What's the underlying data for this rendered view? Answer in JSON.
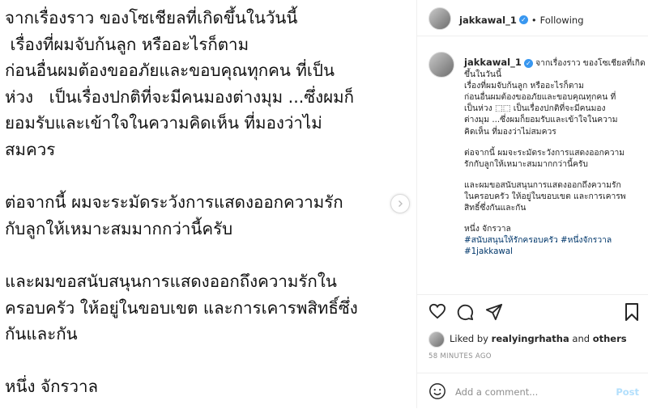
{
  "media": {
    "lines": [
      "จากเรื่องราว ของโซเชียลที่เกิดขึ้นในวันนี้",
      " เรื่องที่ผมจับก้นลูก หรืออะไรก็ตาม",
      "ก่อนอื่นผมต้องขออภัยและขอบคุณทุกคน ที่เป็น",
      "ห่วง   เป็นเรื่องปกติที่จะมีคนมองต่างมุม ...ซึ่งผมก็",
      "ยอมรับและเข้าใจในความคิดเห็น ที่มองว่าไม่",
      "สมควร",
      "",
      "ต่อจากนี้ ผมจะระมัดระวังการแสดงออกความรัก",
      "กับลูกให้เหมาะสมมากกว่านี้ครับ",
      "",
      "และผมขอสนับสนุนการแสดงออกถึงความรักใน",
      "ครอบครัว ให้อยู่ในขอบเขต และการเคารพสิทธิ์ซึ่ง",
      "กันและกัน",
      "",
      "หนึ่ง จักรวาล"
    ]
  },
  "header": {
    "username": "jakkawal_1",
    "separator": "•",
    "follow_status": "Following"
  },
  "caption": {
    "username": "jakkawal_1",
    "para1": "จากเรื่องราว ของโซเชียลที่เกิดขึ้นในวันนี้\nเรื่องที่ผมจับก้นลูก หรืออะไรก็ตาม\nก่อนอื่นผมต้องขออภัยและขอบคุณทุกคน ที่\nเป็นห่วง ⬚⬚ เป็นเรื่องปกติที่จะมีคนมอง\nต่างมุม ...ซึ่งผมก็ยอมรับและเข้าใจในความ\nคิดเห็น ที่มองว่าไม่สมควร",
    "para2": "ต่อจากนี้ ผมจะระมัดระวังการแสดงออกความ\nรักกับลูกให้เหมาะสมมากกว่านี้ครับ",
    "para3": "และผมขอสนับสนุนการแสดงออกถึงความรัก\nในครอบครัว ให้อยู่ในขอบเขต และการเคารพ\nสิทธิ์ซึ่งกันและกัน",
    "signature": "หนึ่ง จักรวาล",
    "hashtags": "#สนับสนุนให้รักครอบครัว #หนึ่งจักรวาล\n#1jakkawal"
  },
  "likes": {
    "prefix": "Liked by",
    "user": "realyingrhatha",
    "and": "and",
    "others": "others"
  },
  "timestamp": "58 MINUTES AGO",
  "comment": {
    "placeholder": "Add a comment...",
    "post_label": "Post"
  },
  "colors": {
    "verified": "#3897f0",
    "hashtag": "#00376b",
    "post_disabled": "#b2dffc",
    "muted": "#8e8e8e"
  },
  "icons": [
    "next-arrow-icon",
    "verified-icon",
    "heart-icon",
    "comment-icon",
    "share-icon",
    "bookmark-icon",
    "emoji-icon"
  ]
}
